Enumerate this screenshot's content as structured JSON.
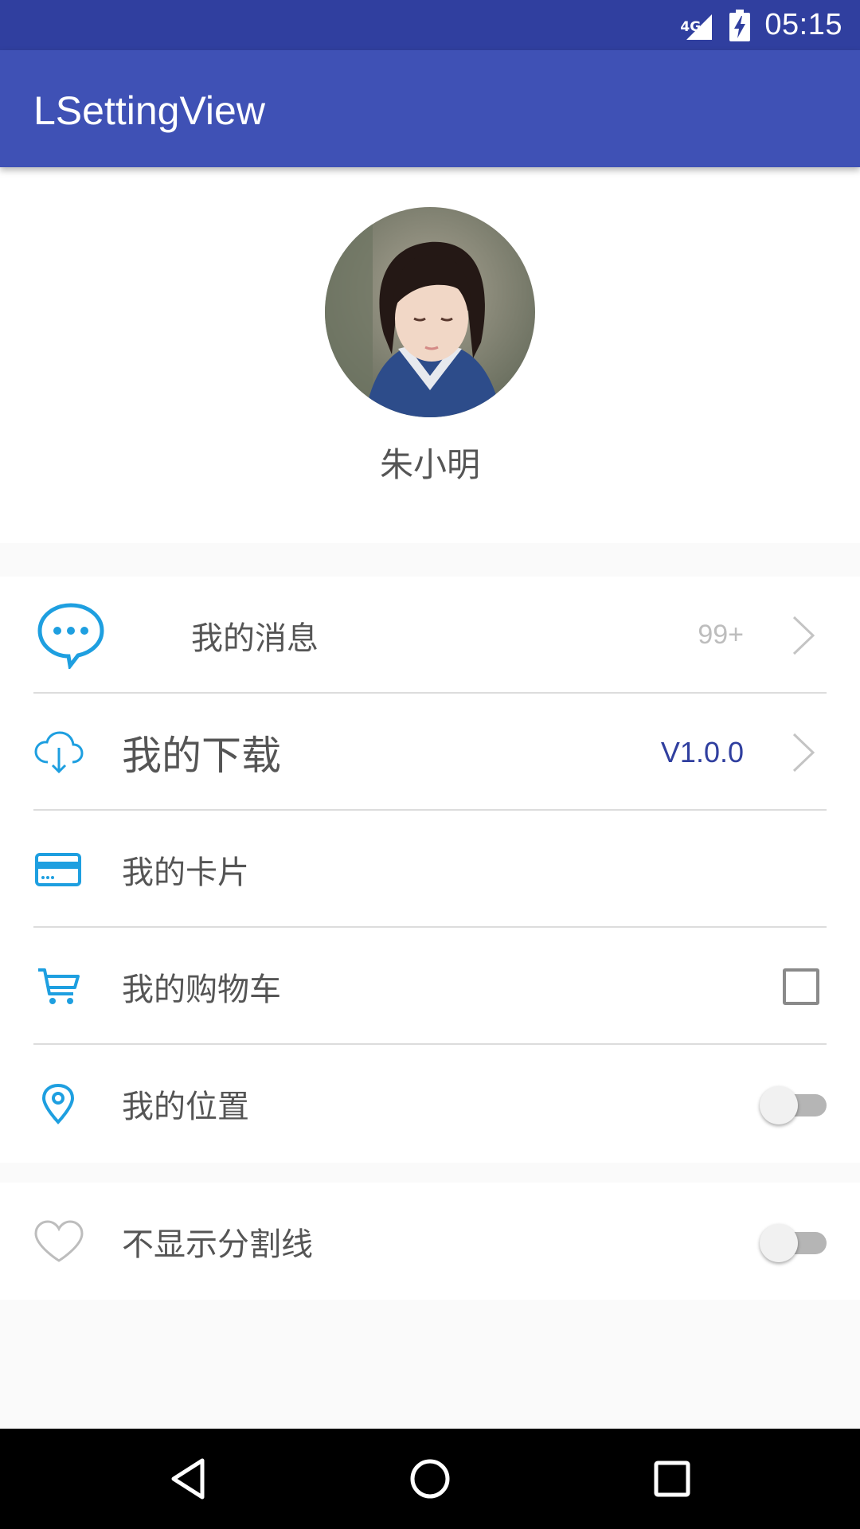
{
  "status_bar": {
    "network": "4G",
    "time": "05:15",
    "icons": [
      "signal-icon",
      "battery-charging-icon"
    ]
  },
  "app_bar": {
    "title": "LSettingView"
  },
  "profile": {
    "name": "朱小明",
    "avatar": "avatar-photo"
  },
  "settings": {
    "messages": {
      "label": "我的消息",
      "badge": "99+",
      "icon": "chat-bubble-icon"
    },
    "downloads": {
      "label": "我的下载",
      "version": "V1.0.0",
      "icon": "cloud-download-icon"
    },
    "cards": {
      "label": "我的卡片",
      "icon": "credit-card-icon"
    },
    "cart": {
      "label": "我的购物车",
      "icon": "cart-icon",
      "checked": false
    },
    "location": {
      "label": "我的位置",
      "icon": "location-pin-icon",
      "enabled": false
    },
    "hide_divider": {
      "label": "不显示分割线",
      "icon": "heart-icon",
      "enabled": false
    }
  },
  "colors": {
    "status_bar": "#303f9f",
    "app_bar": "#3f51b5",
    "icon_blue": "#1e9fe0",
    "version_text": "#303f9f",
    "badge_text": "#bdbdbd"
  },
  "nav_bar": {
    "icons": [
      "back-icon",
      "home-icon",
      "recents-icon"
    ]
  }
}
